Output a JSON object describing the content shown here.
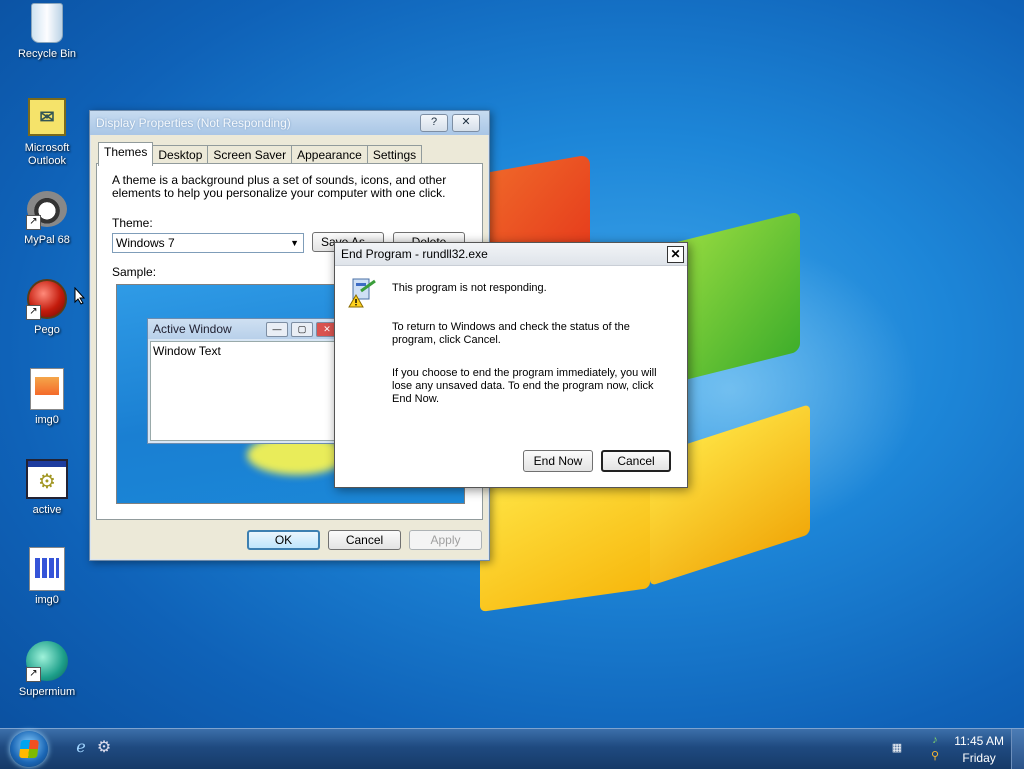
{
  "desktop": {
    "icons": [
      {
        "label": "Recycle Bin",
        "icon": "recycle-bin-icon"
      },
      {
        "label": "Microsoft Outlook",
        "icon": "outlook-icon"
      },
      {
        "label": "MyPal 68",
        "icon": "mypal-icon"
      },
      {
        "label": "Pego",
        "icon": "pego-icon"
      },
      {
        "label": "img0",
        "icon": "image-file-icon"
      },
      {
        "label": "active",
        "icon": "active-app-icon"
      },
      {
        "label": "img0",
        "icon": "image-file-icon"
      },
      {
        "label": "Supermium",
        "icon": "supermium-icon"
      }
    ]
  },
  "display_properties": {
    "title": "Display Properties (Not Responding)",
    "help_label": "?",
    "close_label": "✕",
    "tabs": [
      "Themes",
      "Desktop",
      "Screen Saver",
      "Appearance",
      "Settings"
    ],
    "active_tab": "Themes",
    "description": "A theme is a background plus a set of sounds, icons, and other elements to help you personalize your computer with one click.",
    "theme_label": "Theme:",
    "theme_value": "Windows 7",
    "save_as_label": "Save As...",
    "delete_label": "Delete",
    "sample_label": "Sample:",
    "sample_window_title": "Active Window",
    "sample_window_text": "Window Text",
    "ok_label": "OK",
    "cancel_label": "Cancel",
    "apply_label": "Apply"
  },
  "end_program": {
    "title": "End Program - rundll32.exe",
    "close_label": "✕",
    "line1": "This program is not responding.",
    "line2": "To return to Windows and check the status of the program, click Cancel.",
    "line3": "If you choose to end the program immediately, you will lose any unsaved data. To end the program now, click End Now.",
    "end_now_label": "End Now",
    "cancel_label": "Cancel"
  },
  "taskbar": {
    "time": "11:45 AM",
    "day": "Friday"
  },
  "colors": {
    "desktop_blue": "#1d86d8",
    "taskbar": "#1f4a80",
    "dialog_face": "#ece9d8"
  }
}
